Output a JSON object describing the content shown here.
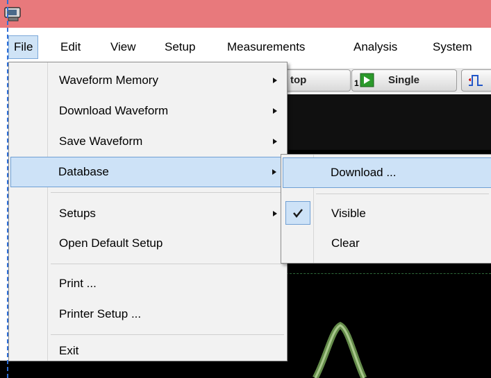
{
  "menubar": {
    "items": [
      "File",
      "Edit",
      "View",
      "Setup",
      "Measurements",
      "Analysis",
      "System"
    ]
  },
  "toolbar": {
    "stop_label": "top",
    "single_label": "Single",
    "run_indicator": "1"
  },
  "file_menu": {
    "items": [
      {
        "label": "Waveform Memory",
        "submenu": true
      },
      {
        "label": "Download Waveform",
        "submenu": true
      },
      {
        "label": "Save Waveform",
        "submenu": true
      },
      {
        "label": "Database",
        "submenu": true
      },
      {
        "label": "Setups",
        "submenu": true
      },
      {
        "label": "Open Default Setup",
        "submenu": false
      },
      {
        "label": "Print ...",
        "submenu": false
      },
      {
        "label": "Printer Setup ...",
        "submenu": false
      },
      {
        "label": "Exit",
        "submenu": false
      }
    ]
  },
  "database_submenu": {
    "items": [
      {
        "label": "Download ...",
        "checked": false
      },
      {
        "label": "Visible",
        "checked": true
      },
      {
        "label": "Clear",
        "checked": false
      }
    ]
  },
  "colors": {
    "titlebar": "#e8797c",
    "highlight": "#cde2f7",
    "highlight_border": "#6f9fd4",
    "trace": "#6f9a52"
  }
}
